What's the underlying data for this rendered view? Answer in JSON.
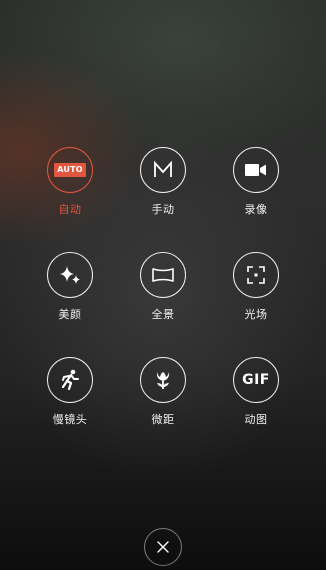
{
  "modes": {
    "row1": [
      {
        "label": "自动",
        "icon": "auto-icon",
        "badge": "AUTO",
        "active": true
      },
      {
        "label": "手动",
        "icon": "m-manual-icon",
        "active": false
      },
      {
        "label": "录像",
        "icon": "video-camera-icon",
        "active": false
      }
    ],
    "row2": [
      {
        "label": "美颜",
        "icon": "sparkle-icon",
        "active": false
      },
      {
        "label": "全景",
        "icon": "panorama-icon",
        "active": false
      },
      {
        "label": "光场",
        "icon": "focus-frame-icon",
        "active": false
      }
    ],
    "row3": [
      {
        "label": "慢镜头",
        "icon": "running-person-icon",
        "active": false
      },
      {
        "label": "微距",
        "icon": "tulip-flower-icon",
        "active": false
      },
      {
        "label": "动图",
        "icon": "gif-icon",
        "badge": "GIF",
        "active": false
      }
    ]
  },
  "close": {
    "icon": "close-icon"
  },
  "colors": {
    "accent": "#e2553f",
    "label": "#f2f2f2",
    "background_top": "#2b2f2b",
    "background_bottom": "#0d0d0d"
  }
}
